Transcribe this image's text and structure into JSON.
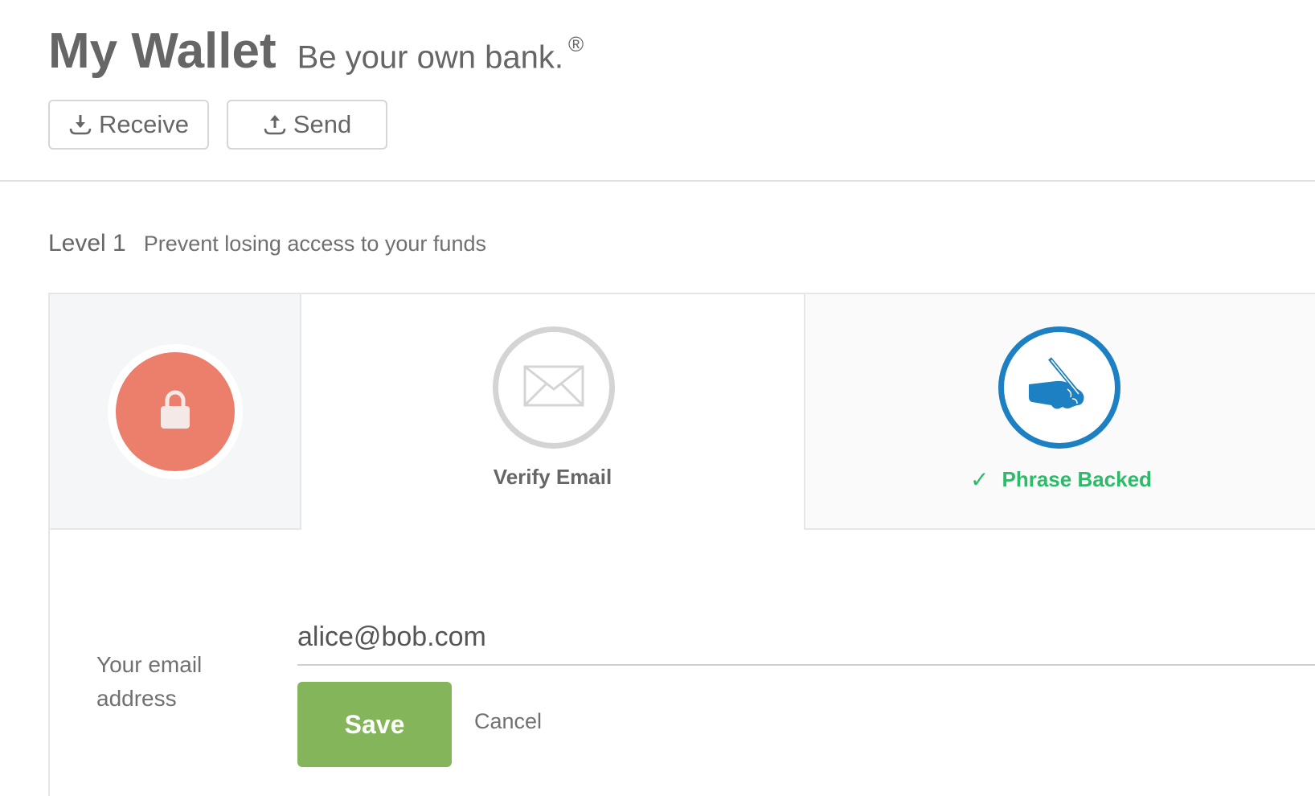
{
  "header": {
    "title": "My Wallet",
    "tagline": "Be your own bank.",
    "tagline_mark": "®",
    "buttons": [
      {
        "label": "Receive",
        "icon": "download-icon"
      },
      {
        "label": "Send",
        "icon": "upload-icon"
      }
    ]
  },
  "level": {
    "label": "Level 1",
    "description": "Prevent losing access to your funds"
  },
  "steps": {
    "lock": {
      "icon": "lock-icon",
      "color": "#ec7e6c"
    },
    "verify_email": {
      "label": "Verify Email",
      "icon": "envelope-icon",
      "color": "#d4d4d4"
    },
    "phrase_backed": {
      "label": "Phrase Backed",
      "icon": "writing-hand-icon",
      "check": "✓",
      "color": "#1d80c3",
      "label_color": "#2dbb6a"
    }
  },
  "form": {
    "field_label": "Your email address",
    "email_value": "alice@bob.com",
    "save_label": "Save",
    "cancel_label": "Cancel",
    "save_color": "#84b55a"
  }
}
